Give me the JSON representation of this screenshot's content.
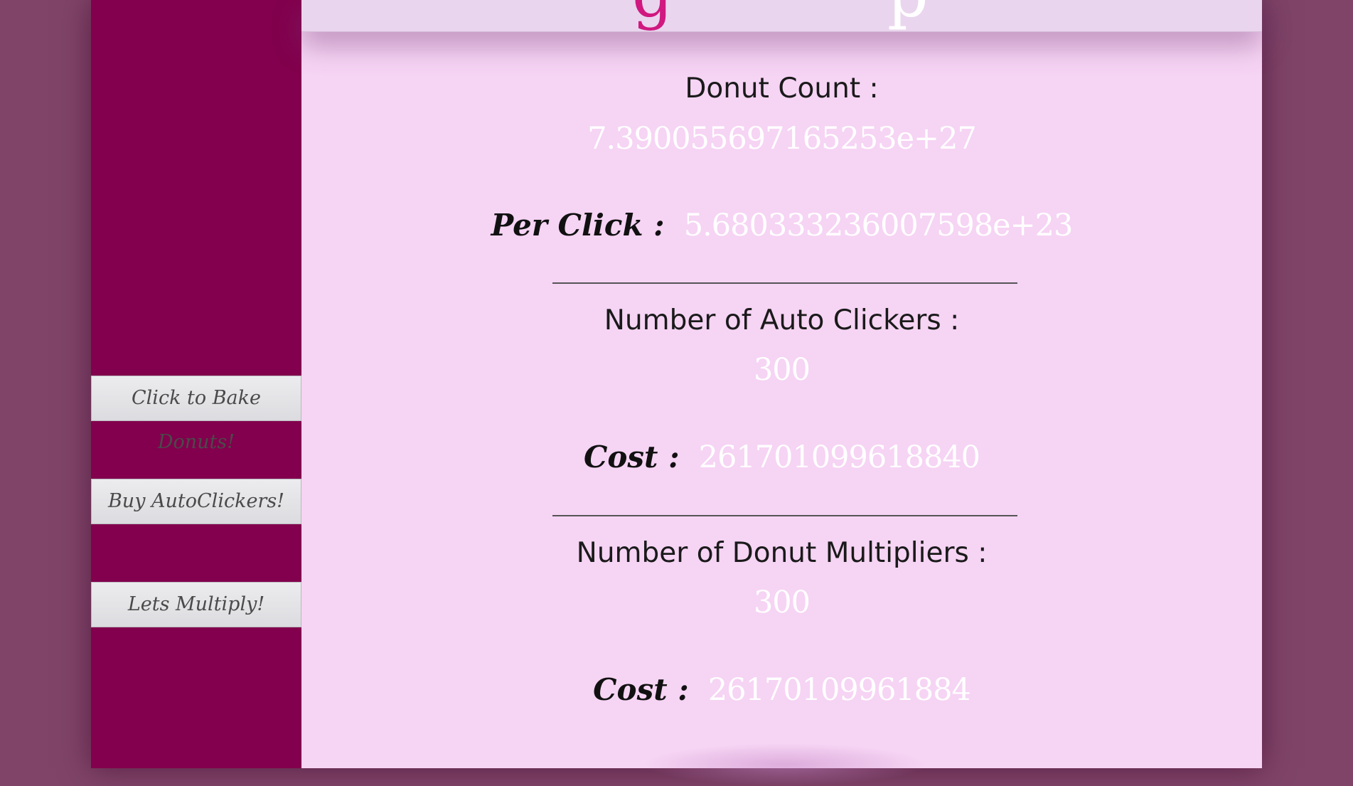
{
  "header": {
    "title_left": "g",
    "title_right": "p"
  },
  "sidebar": {
    "bake_button": "Click to Bake Donuts!",
    "autoclicker_button": "Buy AutoClickers!",
    "multiply_button": "Lets Multiply!"
  },
  "stats": {
    "donut_count_label": "Donut Count :",
    "donut_count_value": "7.390055697165253e+27",
    "per_click_label": "Per Click :",
    "per_click_value": "5.680333236007598e+23",
    "auto_clickers_label": "Number of Auto Clickers :",
    "auto_clickers_value": "300",
    "auto_cost_label": "Cost :",
    "auto_cost_value": "261701099618840",
    "multipliers_label": "Number of Donut Multipliers :",
    "multipliers_value": "300",
    "multiplier_cost_label": "Cost :",
    "multiplier_cost_value": "26170109961884"
  },
  "colors": {
    "sidebar": "#82004d",
    "main_bg": "#f6d4f4",
    "outer_bg": "#7f4468",
    "title_accent": "#d01880"
  }
}
